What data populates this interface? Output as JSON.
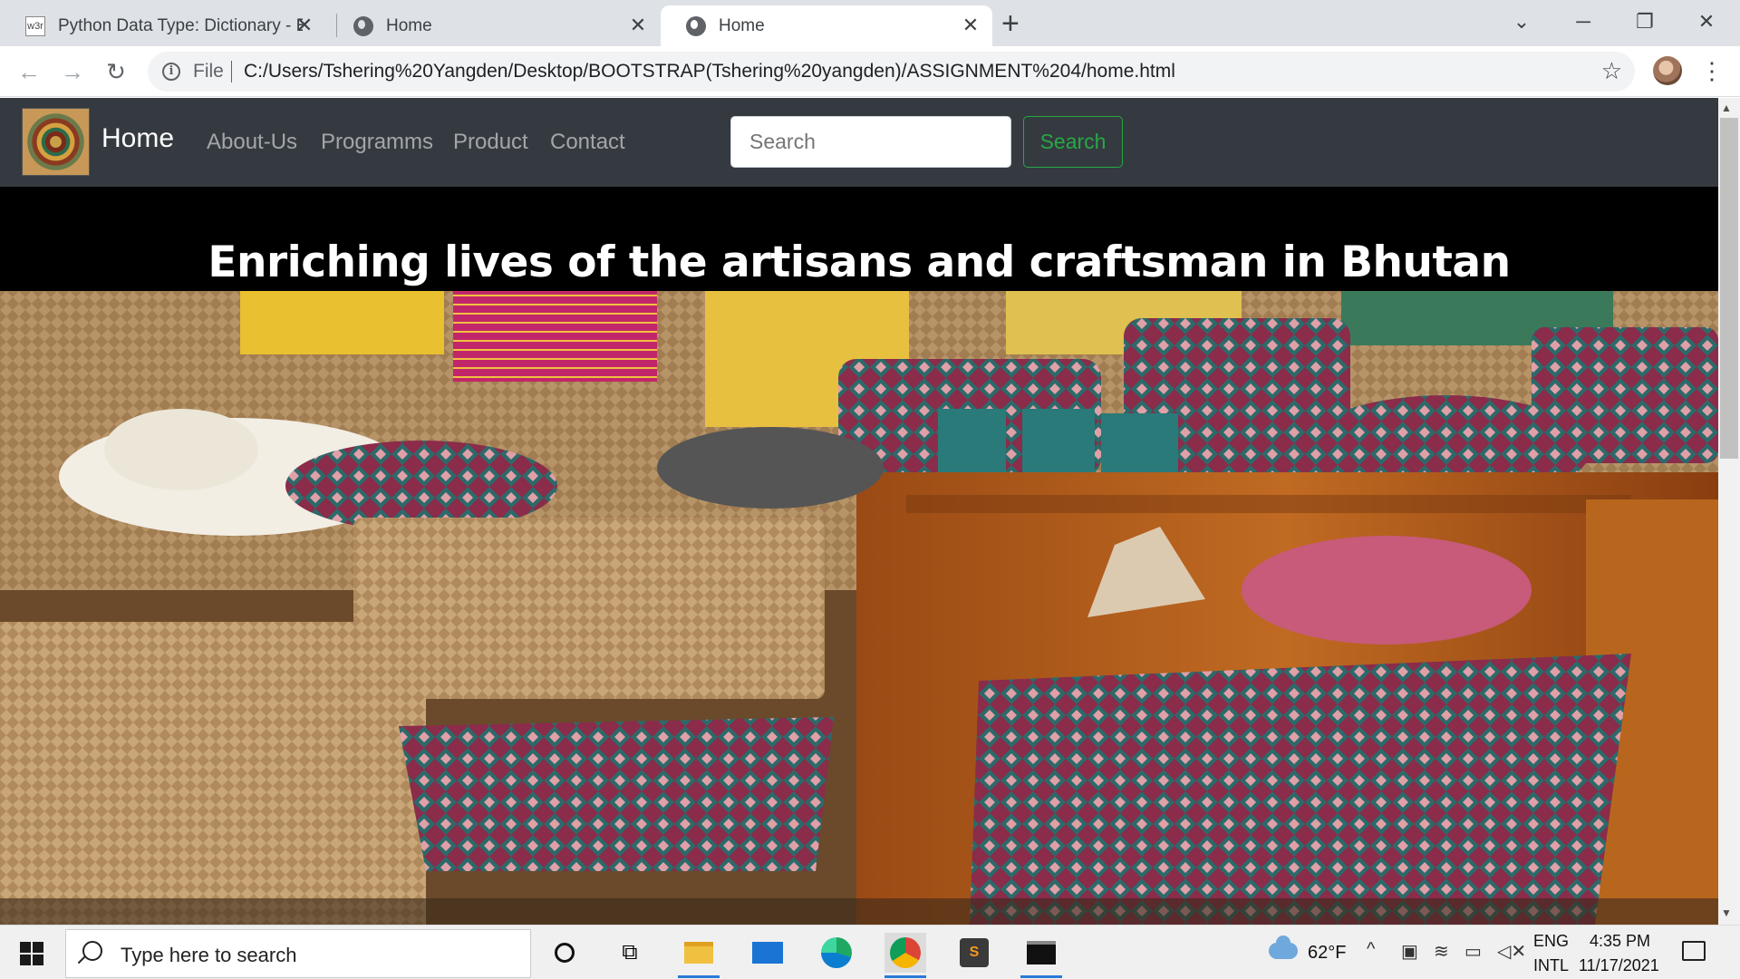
{
  "browser": {
    "tabs": [
      {
        "title": "Python Data Type: Dictionary - Ex",
        "favicon": "w3r",
        "active": false
      },
      {
        "title": "Home",
        "favicon": "globe-icon",
        "active": false
      },
      {
        "title": "Home",
        "favicon": "globe-icon",
        "active": true
      }
    ],
    "new_tab_label": "+",
    "close_label": "✕",
    "file_label": "File",
    "url": "C:/Users/Tshering%20Yangden/Desktop/BOOTSTRAP(Tshering%20yangden)/ASSIGNMENT%204/home.html",
    "window_controls": [
      "⌄",
      "─",
      "❐",
      "✕"
    ]
  },
  "page": {
    "brand": "Home",
    "nav_links": [
      "About-Us",
      "Programms",
      "Product",
      "Contact"
    ],
    "search_placeholder": "Search",
    "search_button": "Search",
    "hero_title": "Enriching lives of the artisans and craftsman in Bhutan",
    "colors": {
      "navbar": "#343a40",
      "success": "#28a745",
      "hero_bg": "#000000"
    }
  },
  "taskbar": {
    "search_placeholder": "Type here to search",
    "weather": "62°F",
    "lang_top": "ENG",
    "lang_bottom": "INTL",
    "time": "4:35 PM",
    "date": "11/17/2021"
  }
}
